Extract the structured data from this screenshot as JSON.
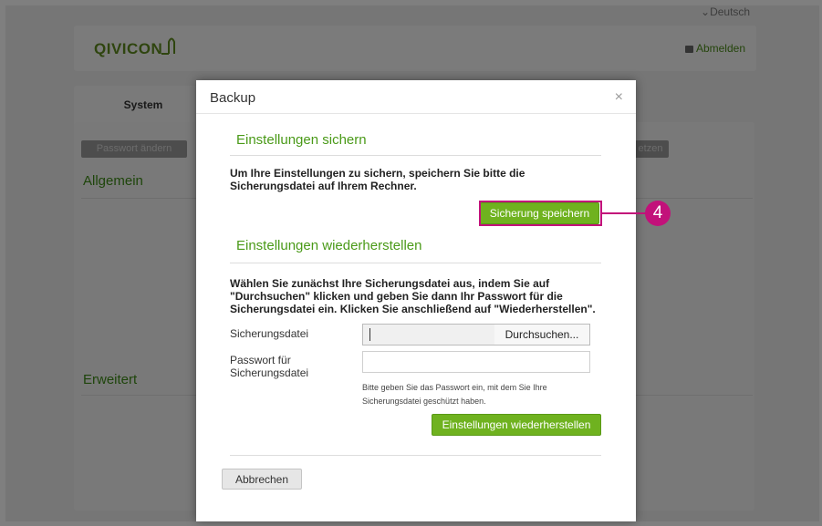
{
  "background": {
    "language": "Deutsch",
    "logo": "QIVICON",
    "logout": "Abmelden",
    "tab_system": "System",
    "btn_password": "Passwort ändern",
    "btn_partial": "etzen",
    "section_general": "Allgemein",
    "section_advanced": "Erweitert"
  },
  "modal": {
    "title": "Backup",
    "close": "×",
    "save_heading": "Einstellungen sichern",
    "save_text": "Um Ihre Einstellungen zu sichern, speichern Sie bitte die Sicherungsdatei auf Ihrem Rechner.",
    "save_button": "Sicherung speichern",
    "restore_heading": "Einstellungen wiederherstellen",
    "restore_text": "Wählen Sie zunächst Ihre Sicherungsdatei aus, indem Sie auf \"Durchsuchen\" klicken und geben Sie dann Ihr Passwort für die Sicherungsdatei ein. Klicken Sie anschließend auf \"Wiederherstellen\".",
    "file_label": "Sicherungsdatei",
    "browse_button": "Durchsuchen...",
    "password_label": "Passwort für Sicherungsdatei",
    "password_hint": "Bitte geben Sie das Passwort ein, mit dem Sie Ihre Sicherungsdatei geschützt haben.",
    "restore_button": "Einstellungen wiederherstellen",
    "cancel_button": "Abbrechen"
  },
  "callout": {
    "number": "4",
    "color": "#c2117a"
  },
  "colors": {
    "accent_green": "#6fb21f",
    "heading_green": "#4a9a18"
  }
}
